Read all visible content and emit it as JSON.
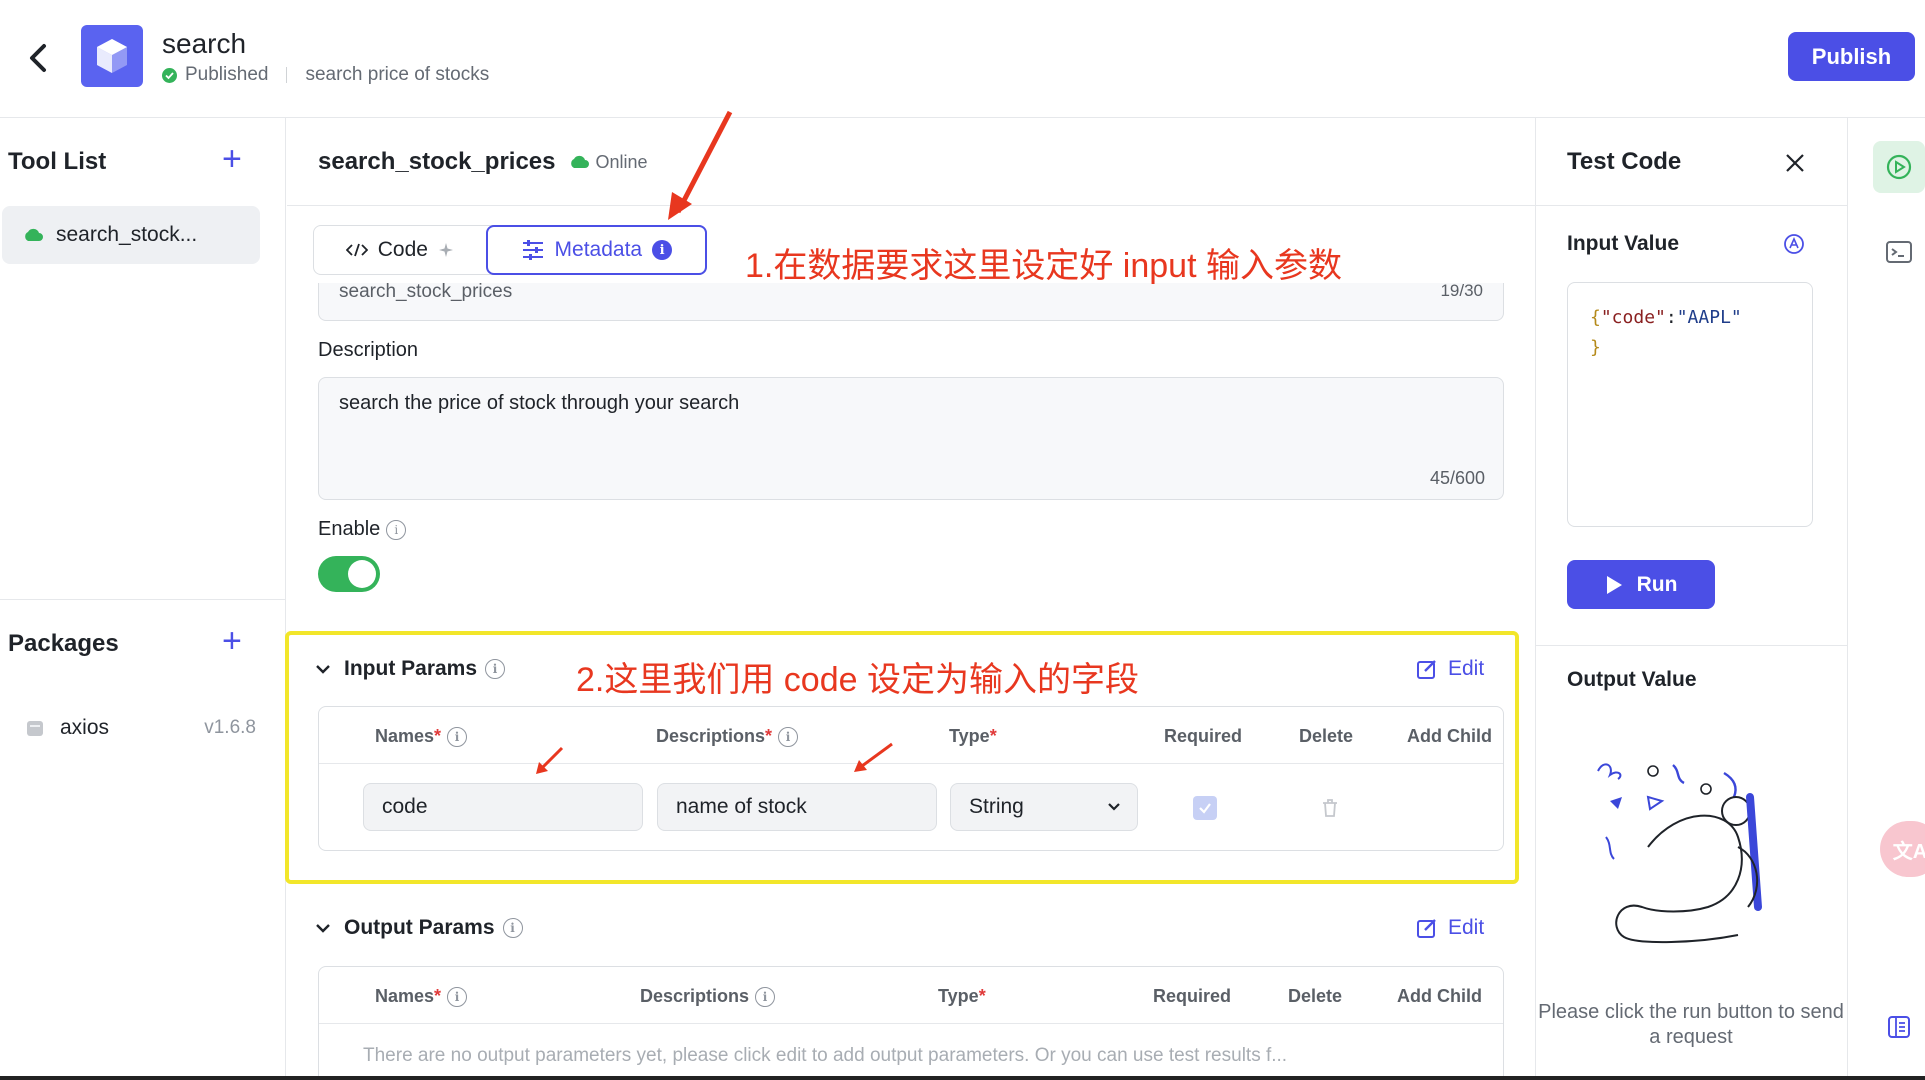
{
  "header": {
    "app_title": "search",
    "status": "Published",
    "subtitle": "search price of stocks",
    "publish_label": "Publish"
  },
  "sidebar": {
    "tool_list_title": "Tool List",
    "tools": [
      {
        "label": "search_stock..."
      }
    ],
    "packages_title": "Packages",
    "packages": [
      {
        "name": "axios",
        "version": "v1.6.8"
      }
    ]
  },
  "main": {
    "tool_title": "search_stock_prices",
    "online_label": "Online",
    "tabs": [
      {
        "label": "Code"
      },
      {
        "label": "Metadata"
      }
    ],
    "name_value": "search_stock_prices",
    "name_counter": "19/30",
    "description_label": "Description",
    "description_value": "search the price of stock through your search",
    "description_counter": "45/600",
    "enable_label": "Enable",
    "enabled": true,
    "input_params": {
      "title": "Input Params",
      "edit_label": "Edit",
      "headers": {
        "names": "Names",
        "descriptions": "Descriptions",
        "type": "Type",
        "required": "Required",
        "delete": "Delete",
        "add_child": "Add Child"
      },
      "rows": [
        {
          "name": "code",
          "description": "name of stock",
          "type": "String",
          "required": true
        }
      ]
    },
    "output_params": {
      "title": "Output Params",
      "edit_label": "Edit",
      "headers": {
        "names": "Names",
        "descriptions": "Descriptions",
        "type": "Type",
        "required": "Required",
        "delete": "Delete",
        "add_child": "Add Child"
      },
      "empty_message": "There are no output parameters yet, please click edit to add output parameters. Or you can use test results f..."
    },
    "annotations": {
      "metadata_note": "1.在数据要求这里设定好 input 输入参数",
      "params_note": "2.这里我们用 code 设定为输入的字段"
    }
  },
  "test_panel": {
    "title": "Test Code",
    "input_label": "Input Value",
    "input_json": {
      "open": "{",
      "key": "\"code\"",
      "colon": ":",
      "value": "\"AAPL\"",
      "close": "}"
    },
    "run_label": "Run",
    "output_label": "Output Value",
    "hint": "Please click the run button to send a request"
  },
  "colors": {
    "accent": "#4b4fe6",
    "success": "#34b35a",
    "annotation": "#e8371f",
    "highlight": "#f2e62a"
  },
  "icons": [
    "back-arrow-icon",
    "cube-logo-icon",
    "check-circle-icon",
    "plus-icon",
    "cloud-icon",
    "code-icon",
    "sparkle-icon",
    "sliders-icon",
    "info-icon",
    "chevron-down-icon",
    "edit-icon",
    "trash-icon",
    "checkbox-icon",
    "close-icon",
    "play-icon",
    "terminal-icon",
    "book-icon",
    "translate-icon"
  ]
}
